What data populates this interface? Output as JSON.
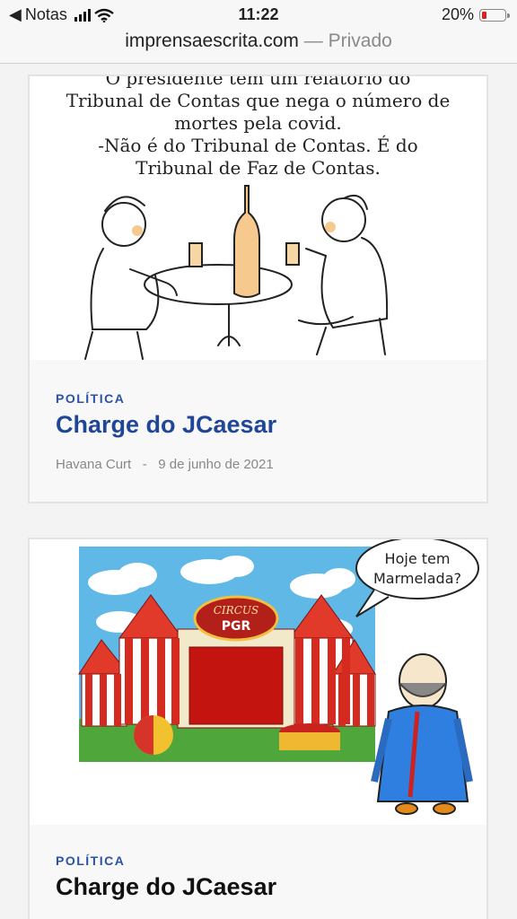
{
  "status_bar": {
    "back_label": "Notas",
    "time": "11:22",
    "battery": "20%",
    "battery_level": 0.2
  },
  "url_bar": {
    "domain": "imprensaescrita.com",
    "separator": " — ",
    "mode": "Privado"
  },
  "posts": [
    {
      "category": "POLÍTICA",
      "title": "Charge do JCaesar",
      "author": "Havana Curt",
      "meta_separator": "-",
      "date": "9 de junho de 2021",
      "image_text": [
        "O presidente tem um relatório do",
        "Tribunal de Contas que nega o número de",
        "mortes pela covid.",
        "-Não é do Tribunal de Contas. É do",
        "Tribunal de Faz de Contas."
      ]
    },
    {
      "category": "POLÍTICA",
      "title": "Charge do JCaesar",
      "image_text": {
        "speech": [
          "Hoje tem",
          "Marmelada?"
        ],
        "sign_top": "CIRCUS",
        "sign_bottom": "PGR"
      }
    }
  ]
}
